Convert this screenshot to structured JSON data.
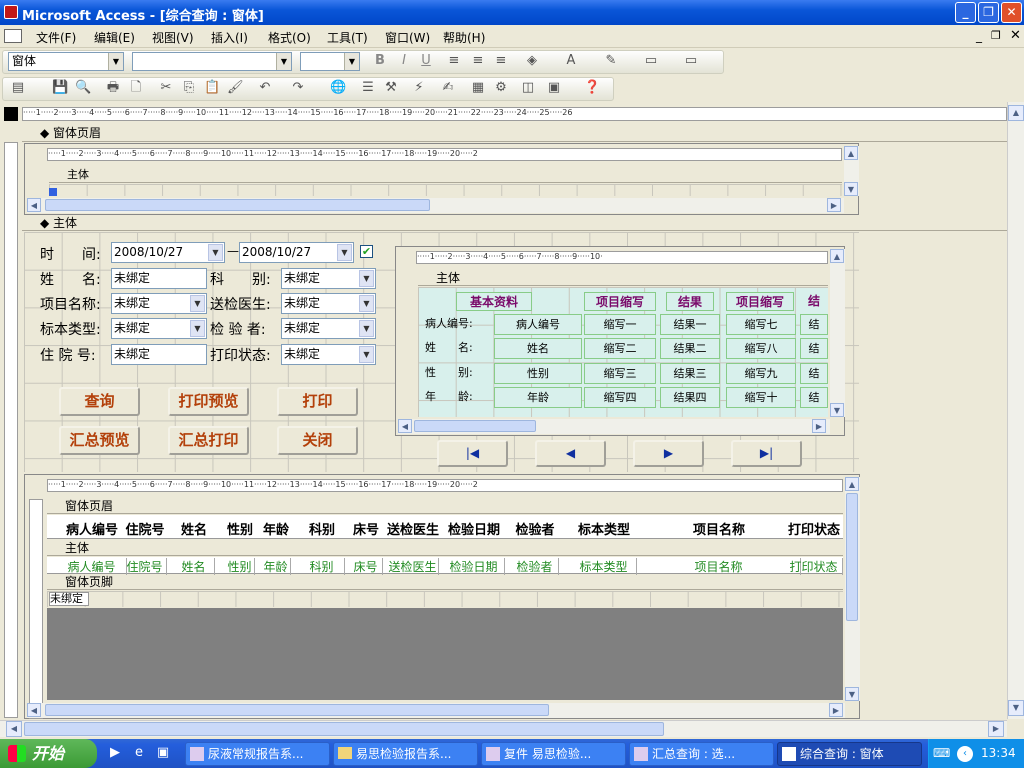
{
  "window": {
    "title": "Microsoft Access - [综合查询 : 窗体]"
  },
  "menu": [
    "文件(F)",
    "编辑(E)",
    "视图(V)",
    "插入(I)",
    "格式(O)",
    "工具(T)",
    "窗口(W)",
    "帮助(H)"
  ],
  "toolbar": {
    "object_combo": "窗体",
    "font_combo": "",
    "size_combo": "",
    "bold": "B",
    "italic": "I",
    "underline": "U"
  },
  "sections": {
    "form_header": "窗体页眉",
    "detail": "主体",
    "form_footer": "窗体页脚"
  },
  "form": {
    "time_label": "时　　间:",
    "date_from": "2008/10/27",
    "date_sep": "—",
    "date_to": "2008/10/27",
    "name_label": "姓　　名:",
    "dept_label": "科　　别:",
    "item_label": "项目名称:",
    "doctor_label": "送检医生:",
    "sample_label": "标本类型:",
    "tester_label": "检 验 者:",
    "inpatient_label": "住 院 号:",
    "print_label": "打印状态:",
    "unbound": "未绑定"
  },
  "buttons": {
    "query": "查询",
    "preview": "打印预览",
    "print": "打印",
    "sum_preview": "汇总预览",
    "sum_print": "汇总打印",
    "close": "关闭"
  },
  "subform2": {
    "headers": [
      "基本资料",
      "项目缩写",
      "结果",
      "项目缩写",
      "结"
    ],
    "rows": [
      [
        "病人编号:",
        "病人编号",
        "缩写一",
        "结果一",
        "缩写七",
        "结"
      ],
      [
        "姓　　名:",
        "姓名",
        "缩写二",
        "结果二",
        "缩写八",
        "结"
      ],
      [
        "性　　别:",
        "性别",
        "缩写三",
        "结果三",
        "缩写九",
        "结"
      ],
      [
        "年　　龄:",
        "年龄",
        "缩写四",
        "结果四",
        "缩写十",
        "结"
      ]
    ]
  },
  "nav": {
    "first": "|◀",
    "prev": "◀",
    "next": "▶",
    "last": "▶|"
  },
  "subform3": {
    "columns": [
      "病人编号",
      "住院号",
      "姓名",
      "性别",
      "年龄",
      "科别",
      "床号",
      "送检医生",
      "检验日期",
      "检验者",
      "标本类型",
      "项目名称",
      "打印状态"
    ],
    "fields": [
      "病人编号",
      "住院号",
      "姓名",
      "性别",
      "年龄",
      "科别",
      "床号",
      "送检医生",
      "检验日期",
      "检验者",
      "标本类型",
      "项目名称",
      "打印状态"
    ],
    "footer_text": "未绑定"
  },
  "taskbar": {
    "start": "开始",
    "tasks": [
      "尿液常规报告系...",
      "易思检验报告系...",
      "复件 易思检验...",
      "汇总查询 : 选...",
      "综合查询 : 窗体"
    ],
    "clock": "13:34"
  }
}
